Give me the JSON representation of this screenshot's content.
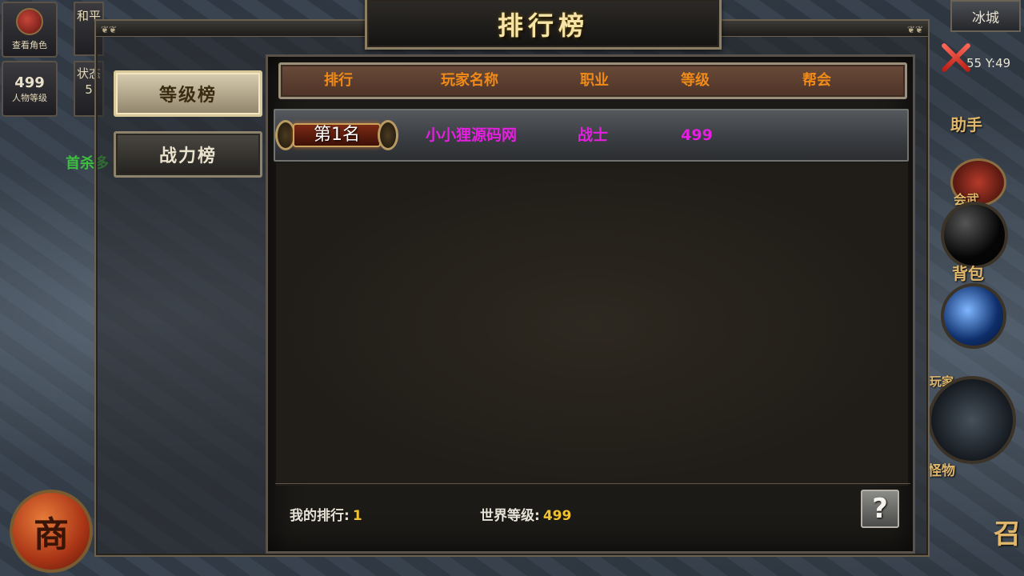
{
  "title": "排行榜",
  "tabs": [
    {
      "label": "等级榜",
      "active": true
    },
    {
      "label": "战力榜",
      "active": false
    }
  ],
  "columns": [
    "排行",
    "玩家名称",
    "职业",
    "等级",
    "帮会"
  ],
  "rows": [
    {
      "rank": "第1名",
      "name": "小小狸源码网",
      "class": "战士",
      "level": "499",
      "guild": ""
    }
  ],
  "footer": {
    "my_rank_label": "我的排行:",
    "my_rank_value": "1",
    "world_level_label": "世界等级:",
    "world_level_value": "499",
    "help_label": "?"
  },
  "hud": {
    "view_role": "查看角色",
    "level_value": "499",
    "level_label": "人物等级",
    "side_top": "和平",
    "side_status": "状态5",
    "map_name": "冰城",
    "coords": "55 Y:49",
    "world_green_text": "首杀多",
    "helper_label": "助手",
    "bag_label": "背包",
    "battle_label": "会武",
    "players_label": "玩家",
    "monster_label": "怪物",
    "summon_label": "召",
    "shop_label": "商"
  },
  "colors": {
    "header_text": "#f08a18",
    "row_text": "#e51fe0",
    "footer_value": "#f2c12e",
    "title": "#f6e5a6"
  }
}
